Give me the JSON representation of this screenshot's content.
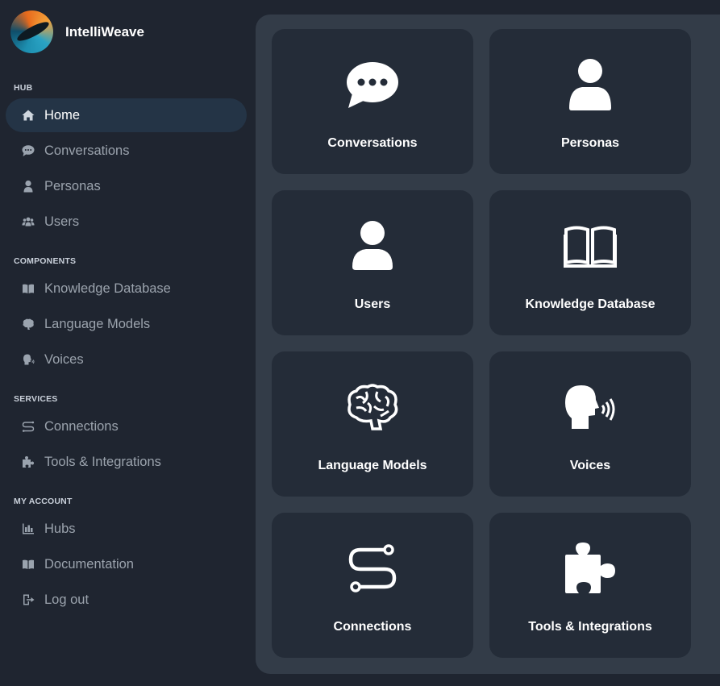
{
  "brand": {
    "name": "IntelliWeave"
  },
  "sidebar": {
    "sections": [
      {
        "label": "HUB"
      },
      {
        "label": "COMPONENTS"
      },
      {
        "label": "SERVICES"
      },
      {
        "label": "MY ACCOUNT"
      }
    ],
    "items": [
      {
        "label": "Home",
        "icon": "home-icon",
        "active": true
      },
      {
        "label": "Conversations",
        "icon": "chat-icon"
      },
      {
        "label": "Personas",
        "icon": "person-icon"
      },
      {
        "label": "Users",
        "icon": "users-icon"
      },
      {
        "label": "Knowledge Database",
        "icon": "book-icon"
      },
      {
        "label": "Language Models",
        "icon": "brain-icon"
      },
      {
        "label": "Voices",
        "icon": "voice-icon"
      },
      {
        "label": "Connections",
        "icon": "route-icon"
      },
      {
        "label": "Tools & Integrations",
        "icon": "puzzle-icon"
      },
      {
        "label": "Hubs",
        "icon": "hub-icon"
      },
      {
        "label": "Documentation",
        "icon": "book-icon"
      },
      {
        "label": "Log out",
        "icon": "logout-icon"
      }
    ]
  },
  "cards": [
    {
      "label": "Conversations",
      "icon": "chat-bubble-icon"
    },
    {
      "label": "Personas",
      "icon": "person-icon"
    },
    {
      "label": "Users",
      "icon": "user-icon"
    },
    {
      "label": "Knowledge Database",
      "icon": "book-open-icon"
    },
    {
      "label": "Language Models",
      "icon": "brain-icon"
    },
    {
      "label": "Voices",
      "icon": "voice-icon"
    },
    {
      "label": "Connections",
      "icon": "route-icon"
    },
    {
      "label": "Tools & Integrations",
      "icon": "puzzle-icon"
    }
  ],
  "colors": {
    "background": "#1f2530",
    "panel": "#333c48",
    "card": "#242c38",
    "active_item": "#243446"
  }
}
